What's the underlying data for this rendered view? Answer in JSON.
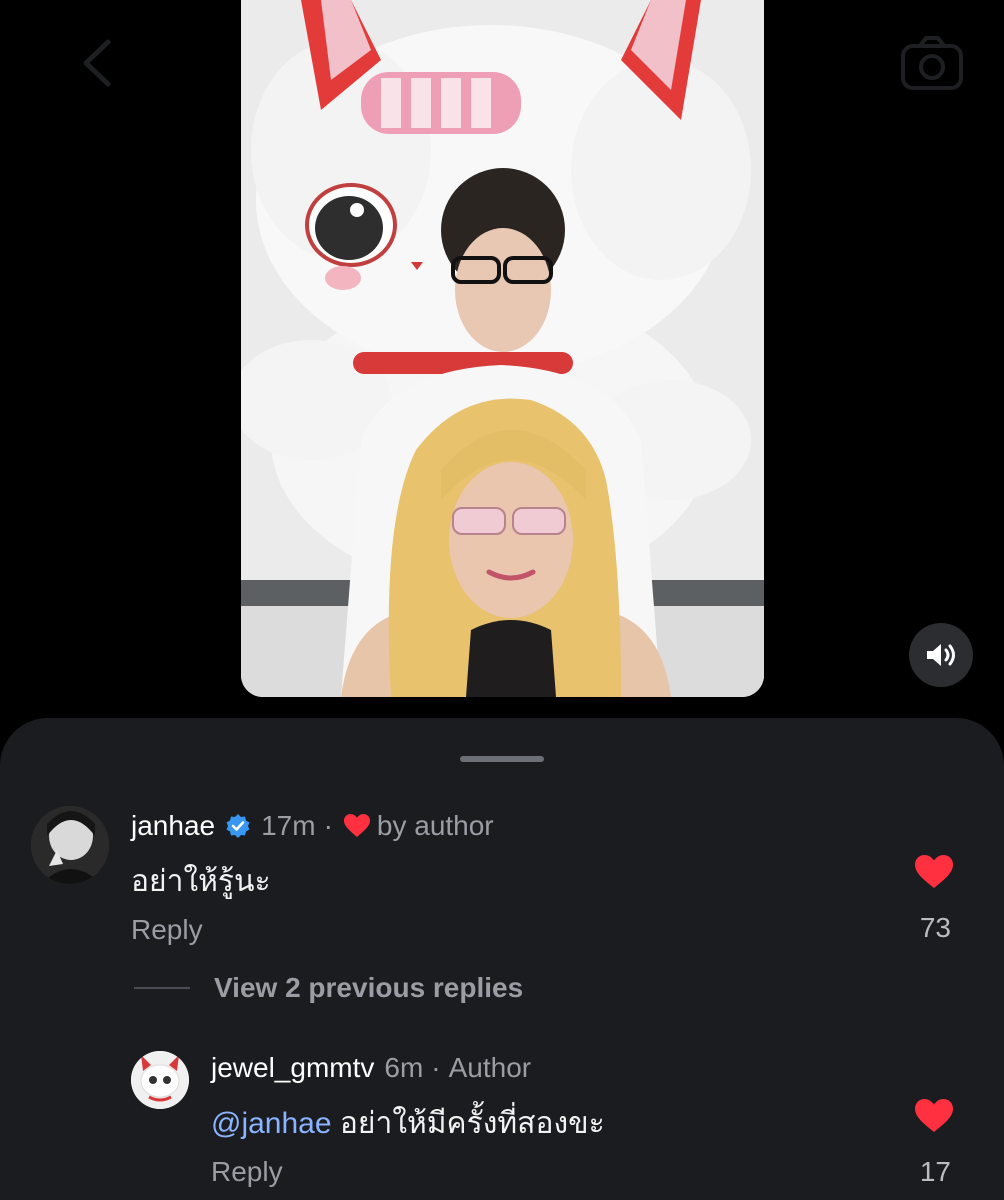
{
  "colors": {
    "sheet_bg": "#1a1c20",
    "like_red": "#ff3040",
    "verified_blue": "#3897f0",
    "mention_blue": "#8ab4ff",
    "muted_text": "#9a9da3"
  },
  "icons": {
    "back": "chevron-left-icon",
    "camera": "camera-icon",
    "sound": "speaker-icon",
    "verified": "verified-badge-icon",
    "like": "heart-icon"
  },
  "comments": [
    {
      "username": "janhae",
      "verified": true,
      "time": "17m",
      "separator": "·",
      "liked_by_author_label": "by author",
      "text": "อย่าให้รู้นะ",
      "reply_label": "Reply",
      "likes": "73",
      "liked": true
    }
  ],
  "view_replies_label": "View 2 previous replies",
  "replies": [
    {
      "username": "jewel_gmmtv",
      "time": "6m",
      "separator": "·",
      "author_label": "Author",
      "mention": "@janhae",
      "text": " อย่าให้มีครั้งที่สองขะ",
      "reply_label": "Reply",
      "likes": "17",
      "liked": true
    }
  ]
}
